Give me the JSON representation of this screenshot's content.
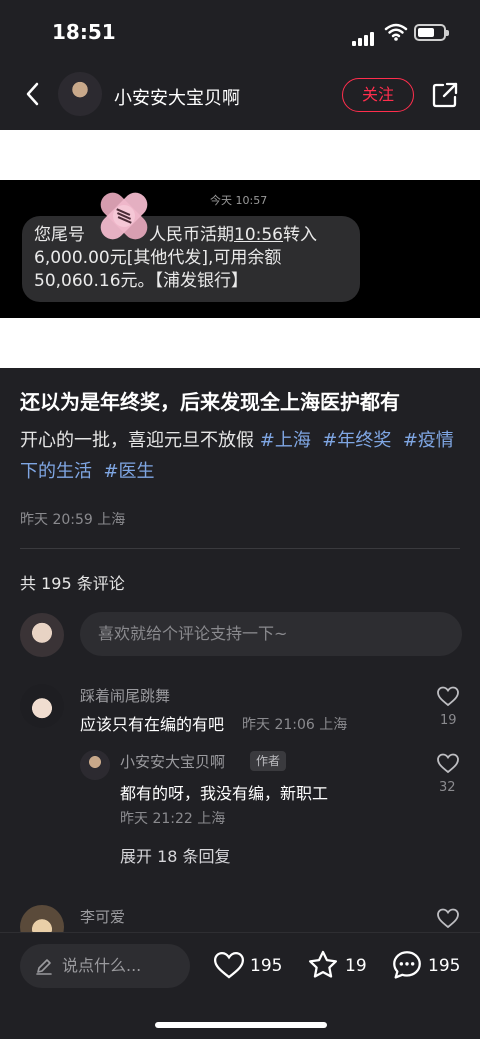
{
  "status_bar": {
    "time": "18:51"
  },
  "header": {
    "username": "小安安大宝贝啊",
    "follow_label": "关注"
  },
  "post_image": {
    "sms_time": "今天 10:57",
    "sms_line1_a": "您尾号",
    "sms_line1_b": "人民币活期",
    "sms_line1_time": "10:56",
    "sms_line1_c": "转入",
    "sms_line2": "6,000.00元[其他代发],可用余额",
    "sms_line3": "50,060.16元。【浦发银行】"
  },
  "post": {
    "title": "还以为是年终奖，后来发现全上海医护都有",
    "body_text_1": "开心的一批，喜迎元旦不放假 ",
    "tags": [
      "#上海",
      "#年终奖",
      "#疫情下的生活",
      "#医生"
    ],
    "meta": "昨天 20:59 上海"
  },
  "comments_section": {
    "count_label": "共 195 条评论",
    "input_placeholder": "喜欢就给个评论支持一下~",
    "comments": [
      {
        "name": "踩着闹尾跳舞",
        "text": "应该只有在编的有吧",
        "meta": "昨天 21:06 上海",
        "likes": "19",
        "replies": [
          {
            "name": "小安安大宝贝啊",
            "badge": "作者",
            "text": "都有的呀，我没有编，新职工",
            "meta": "昨天 21:22 上海",
            "likes": "32"
          }
        ],
        "expand_label": "展开 18 条回复"
      },
      {
        "name": "李可爱"
      }
    ]
  },
  "bottom_bar": {
    "input_placeholder": "说点什么...",
    "likes": "195",
    "stars": "19",
    "comments": "195"
  }
}
